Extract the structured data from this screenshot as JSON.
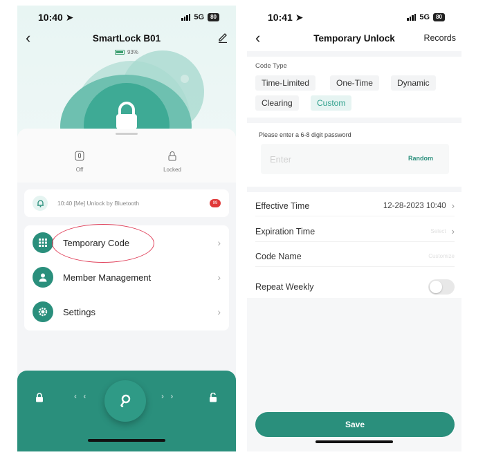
{
  "left": {
    "status": {
      "time": "10:40",
      "network": "5G",
      "battery": "80"
    },
    "title": "SmartLock B01",
    "battery_percent": "93%",
    "states": [
      {
        "label": "Off",
        "icon": "door-sensor-icon"
      },
      {
        "label": "Locked",
        "icon": "lock-state-icon"
      }
    ],
    "log": {
      "text": "10:40 [Me] Unlock by Bluetooth",
      "badge": "99"
    },
    "menu": [
      {
        "label": "Temporary Code",
        "icon": "keypad-icon"
      },
      {
        "label": "Member Management",
        "icon": "person-icon"
      },
      {
        "label": "Settings",
        "icon": "gear-icon"
      }
    ],
    "bottom": {
      "left_arrows": "‹ ‹",
      "right_arrows": "› ›"
    },
    "colors": {
      "accent": "#2a8f7c",
      "annotation": "#e0405a"
    }
  },
  "right": {
    "status": {
      "time": "10:41",
      "network": "5G",
      "battery": "80"
    },
    "title": "Temporary Unlock",
    "records": "Records",
    "code_type_label": "Code Type",
    "code_types": [
      "Time-Limited",
      "One-Time",
      "Dynamic",
      "Clearing",
      "Custom"
    ],
    "selected_code_type": "Custom",
    "password_label": "Please enter a 6-8 digit password",
    "password_placeholder": "Enter",
    "password_value": "",
    "random": "Random",
    "effective_time_label": "Effective Time",
    "effective_time_value": "12-28-2023 10:40",
    "expiration_time_label": "Expiration Time",
    "expiration_time_placeholder": "Select",
    "code_name_label": "Code Name",
    "code_name_placeholder": "Customize",
    "repeat_label": "Repeat Weekly",
    "repeat_on": false,
    "save": "Save"
  }
}
